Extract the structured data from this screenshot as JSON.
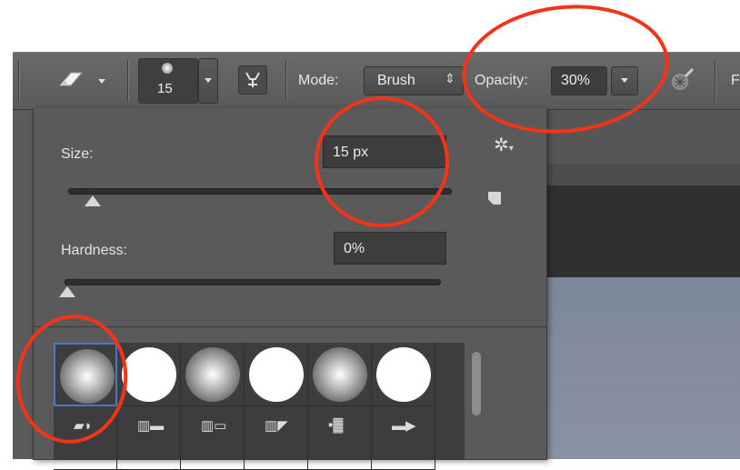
{
  "toolbar": {
    "brush_size_label": "15",
    "mode_label": "Mode:",
    "mode_value": "Brush",
    "opacity_label": "Opacity:",
    "opacity_value": "30%",
    "cut_label": "F"
  },
  "panel": {
    "size_label": "Size:",
    "size_value": "15 px",
    "size_slider_fraction": 0.0,
    "hardness_label": "Hardness:",
    "hardness_value": "0%",
    "hardness_slider_fraction": 0.0
  },
  "brush_presets": [
    {
      "kind": "soft"
    },
    {
      "kind": "hard"
    },
    {
      "kind": "soft"
    },
    {
      "kind": "hard"
    },
    {
      "kind": "soft"
    },
    {
      "kind": "hard"
    }
  ],
  "colors": {
    "annotation": "#f43318",
    "panel": "#5a5a5a",
    "selected_border": "#4a78c8"
  }
}
